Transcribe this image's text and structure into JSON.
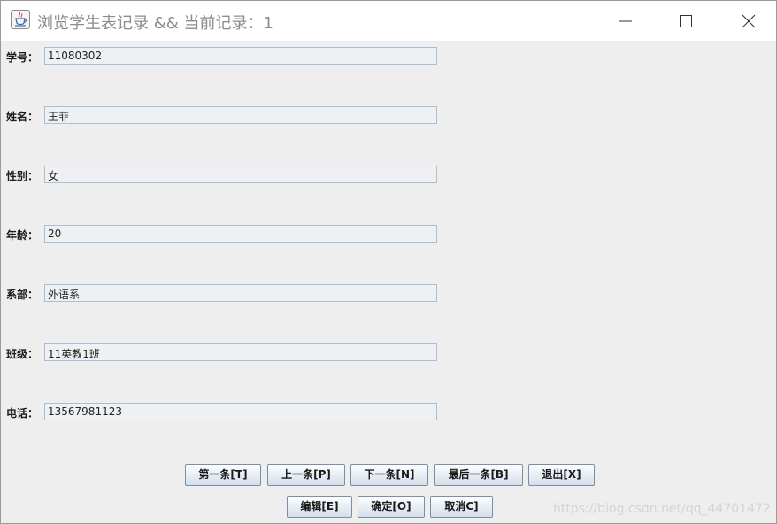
{
  "window": {
    "title": "浏览学生表记录 && 当前记录：1",
    "controls": [
      "minimize-icon",
      "maximize-icon",
      "close-icon"
    ]
  },
  "fields": [
    {
      "label": "学号：",
      "value": "11080302"
    },
    {
      "label": "姓名：",
      "value": "王菲"
    },
    {
      "label": "性别：",
      "value": "女"
    },
    {
      "label": "年龄：",
      "value": "20"
    },
    {
      "label": "系部：",
      "value": "外语系"
    },
    {
      "label": "班级：",
      "value": "11英教1班"
    },
    {
      "label": "电话：",
      "value": "13567981123"
    }
  ],
  "nav_buttons": {
    "first": "第一条[T]",
    "prev": "上一条[P]",
    "next": "下一条[N]",
    "last": "最后一条[B]",
    "exit": "退出[X]"
  },
  "edit_buttons": {
    "edit": "编辑[E]",
    "ok": "确定[O]",
    "cancel": "取消C]"
  },
  "watermark": "https://blog.csdn.net/qq_44701472",
  "colors": {
    "window_bg": "#eeeeee",
    "field_border": "#a8bfd6",
    "title_text": "#8c8c8c"
  }
}
